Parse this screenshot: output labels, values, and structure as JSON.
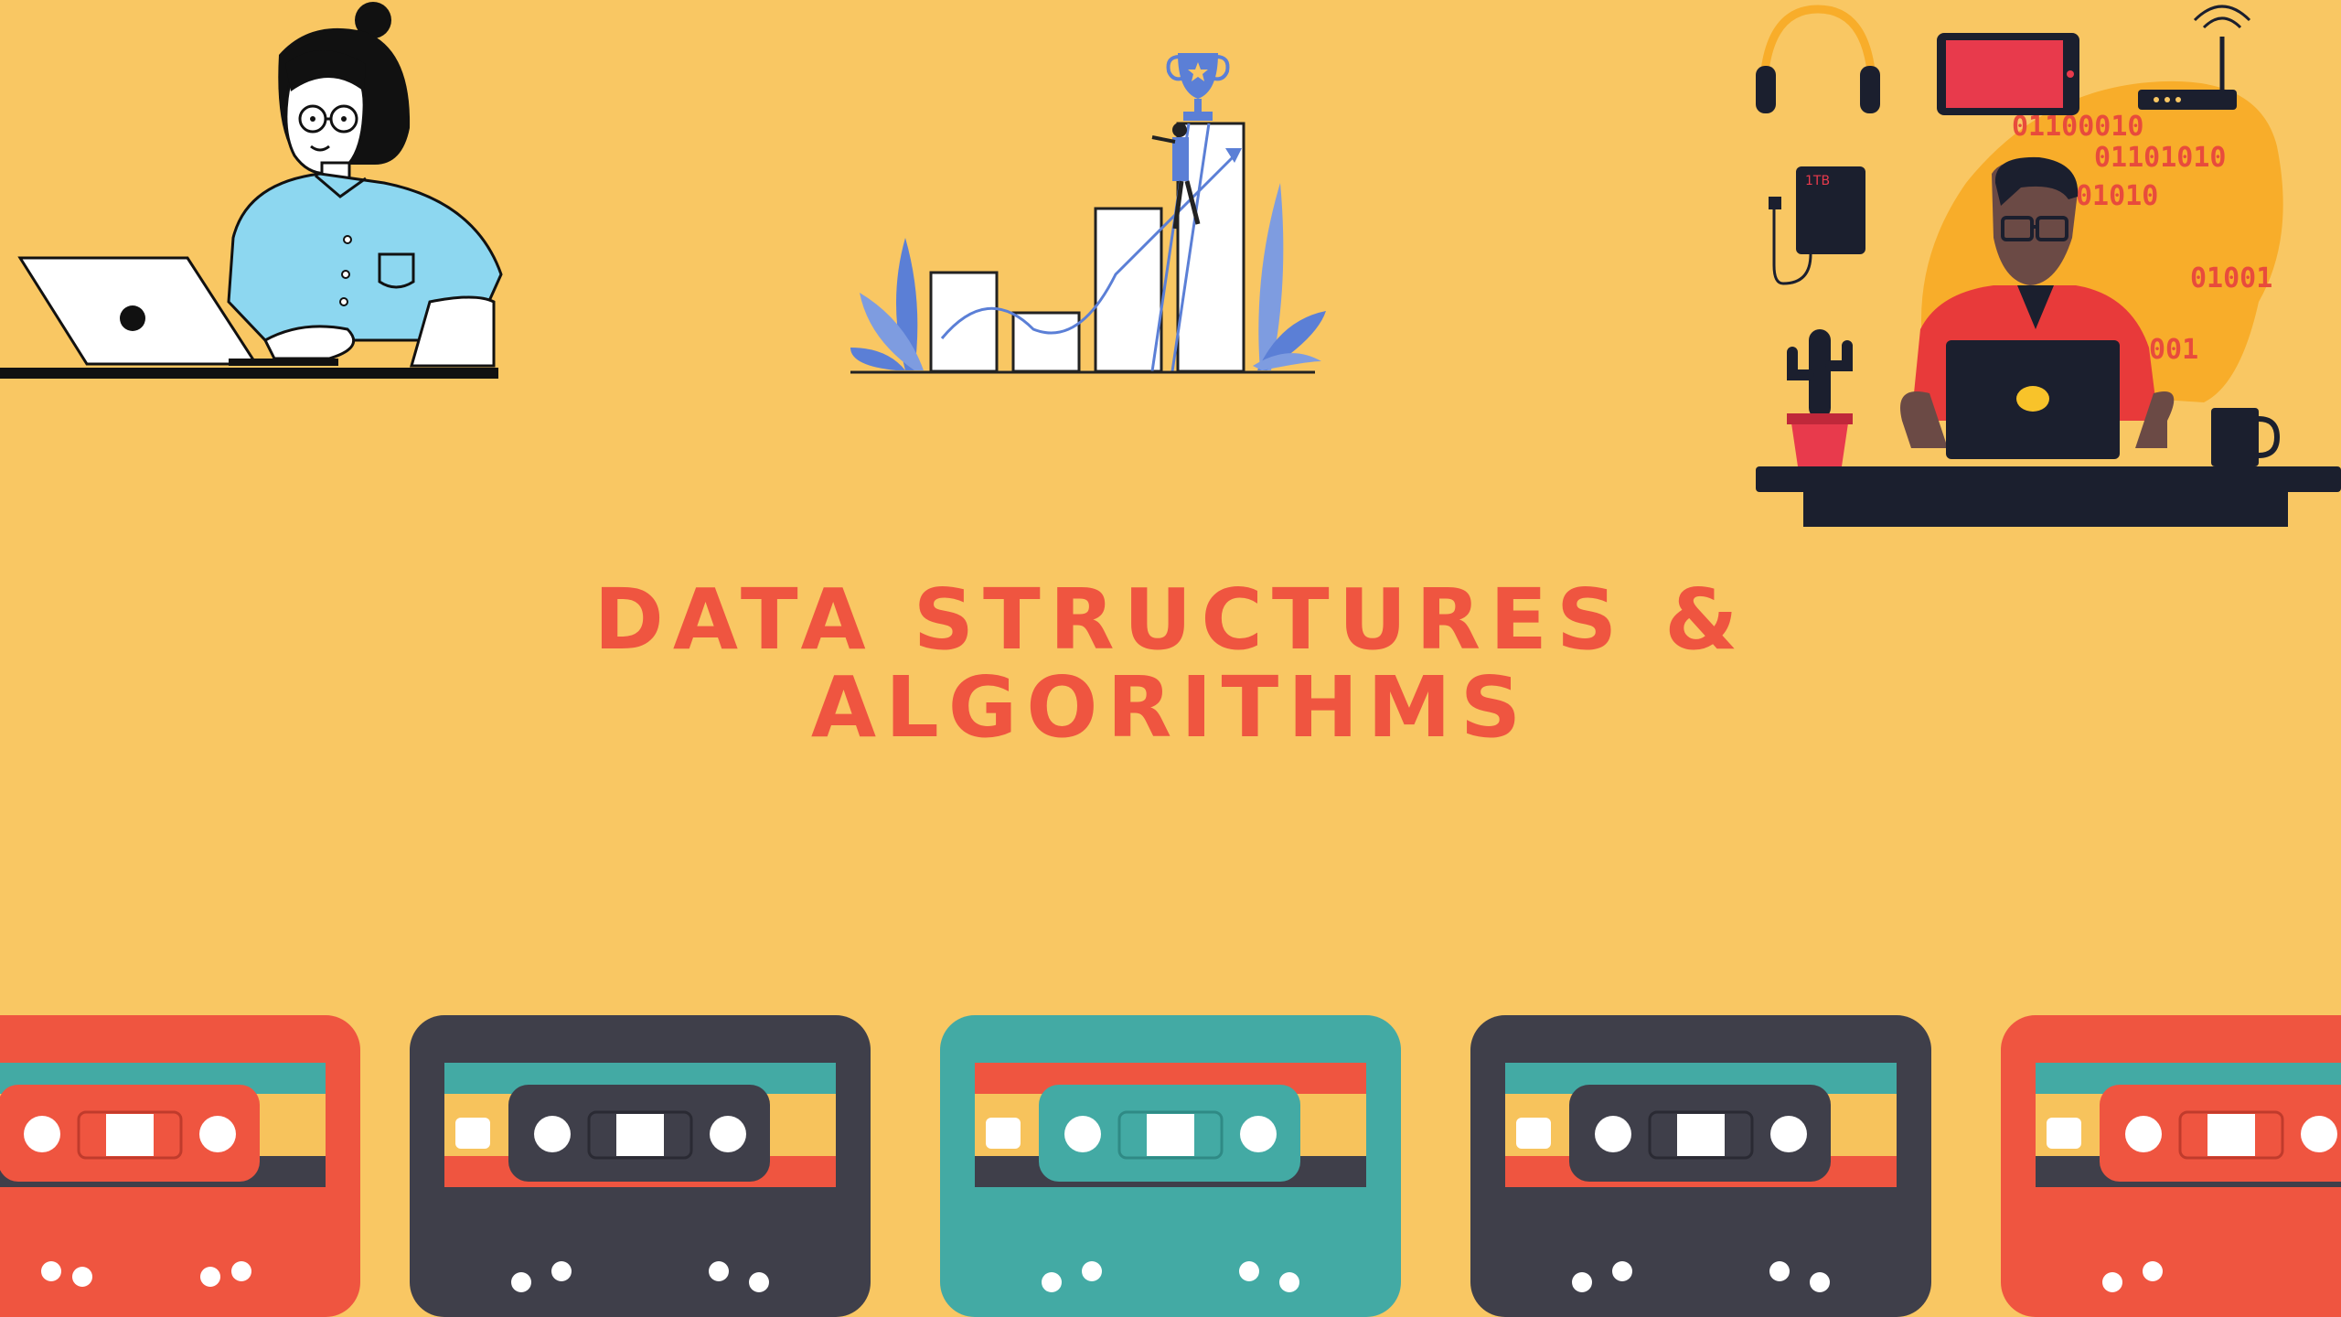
{
  "title": {
    "line1": "DATA STRUCTURES &",
    "line2": "ALGORITHMS"
  },
  "illustrations": {
    "woman": "woman-with-laptop-illustration",
    "growth": "growth-chart-with-trophy-illustration",
    "tech": "man-at-desk-with-devices-illustration"
  },
  "binary_text": [
    "01100010",
    "01101010",
    "01010",
    "01001",
    "001"
  ],
  "hard_drive_label": "1TB",
  "palette": {
    "background": "#f9c763",
    "title_red": "#ef5540",
    "cassette_red": "#ef5540",
    "cassette_dark": "#3f3f4a",
    "cassette_teal": "#43aaa4"
  }
}
